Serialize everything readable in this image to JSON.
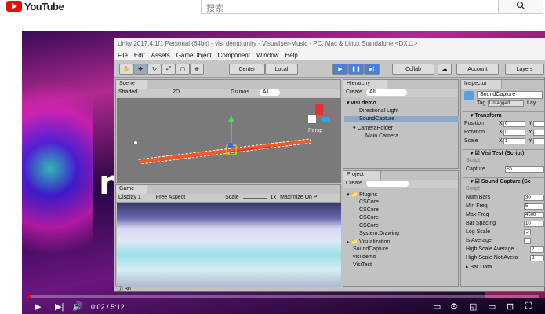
{
  "youtube": {
    "logo_text": "YouTube",
    "search_placeholder": "搜索"
  },
  "unity": {
    "title": "Unity 2017.4.1f1 Personal (64bit) - visi demo.unity - Visualiser-Music - PC, Mac & Linux Standalone <DX11>",
    "menu": [
      "File",
      "Edit",
      "Assets",
      "GameObject",
      "Component",
      "Window",
      "Help"
    ],
    "toolbar": {
      "center": "Center",
      "local": "Local",
      "collab": "Collab",
      "account": "Account",
      "layers": "Layers"
    },
    "scene": {
      "tab": "Scene",
      "shading": "Shaded",
      "mode_2d": "2D",
      "gizmos": "Gizmos",
      "search": "All",
      "persp": "Persp"
    },
    "game": {
      "tab": "Game",
      "display": "Display 1",
      "aspect": "Free Aspect",
      "scale_label": "Scale",
      "scale_value": "1x",
      "maximize": "Maximize On P"
    },
    "hierarchy": {
      "tab": "Hierarchy",
      "create": "Create",
      "search": "All",
      "scene": "visi demo",
      "items": [
        "Directional Light",
        "SoundCapture",
        "CameraHolder",
        "Main Camera"
      ]
    },
    "project": {
      "tab": "Project",
      "create": "Create",
      "items": [
        "Plugins",
        "CSCore",
        "CSCore",
        "CSCore",
        "CSCore",
        "System.Drawing",
        "Visualization",
        "SoundCapture",
        "visi demo",
        "VisiTest"
      ]
    },
    "inspector": {
      "tab": "Inspector",
      "object_name": "SoundCapture",
      "tag_label": "Tag",
      "tag_value": "Untagged",
      "layer_label": "Lay",
      "transform": {
        "title": "Transform",
        "position": "Position",
        "rotation": "Rotation",
        "scale": "Scale",
        "x_label": "X",
        "y_label": "Y",
        "position_x": "0",
        "rotation_x": "0",
        "scale_x": "1"
      },
      "visi_test": {
        "title": "Visi Test (Script)",
        "script_label": "Script",
        "capture_label": "Capture",
        "capture_value": "So"
      },
      "sound_capture": {
        "title": "Sound Capture (Sc",
        "script_label": "Script",
        "fields": [
          {
            "label": "Num Bars",
            "value": "30"
          },
          {
            "label": "Min Freq",
            "value": "5"
          },
          {
            "label": "Max Freq",
            "value": "4500"
          },
          {
            "label": "Bar Spacing",
            "value": "10"
          },
          {
            "label": "Log Scale",
            "value": "✓"
          },
          {
            "label": "Is Average",
            "value": ""
          },
          {
            "label": "High Scale Average",
            "value": "2"
          },
          {
            "label": "High Scale Not Avera",
            "value": "3"
          }
        ],
        "bar_data": "Bar Data"
      }
    },
    "status": "30"
  },
  "player": {
    "time_current": "0:02",
    "time_separator": "/",
    "time_total": "5:12",
    "progress_fraction": 0.006
  }
}
